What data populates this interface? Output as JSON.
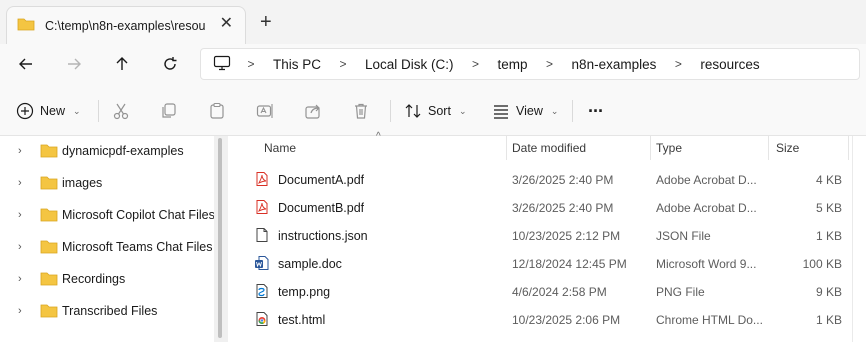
{
  "tab": {
    "title": "C:\\temp\\n8n-examples\\resou",
    "close": "✕",
    "new_tab": "+"
  },
  "nav": {
    "back": "back",
    "forward": "forward",
    "up": "up",
    "refresh": "refresh"
  },
  "breadcrumb": [
    "This PC",
    "Local Disk (C:)",
    "temp",
    "n8n-examples",
    "resources"
  ],
  "toolbar": {
    "new_label": "New",
    "sort_label": "Sort",
    "view_label": "View",
    "more": "···"
  },
  "sidebar": {
    "items": [
      {
        "label": "dynamicpdf-examples"
      },
      {
        "label": "images"
      },
      {
        "label": "Microsoft Copilot Chat Files"
      },
      {
        "label": "Microsoft Teams Chat Files"
      },
      {
        "label": "Recordings"
      },
      {
        "label": "Transcribed Files"
      }
    ]
  },
  "columns": {
    "name": "Name",
    "date": "Date modified",
    "type": "Type",
    "size": "Size"
  },
  "files": [
    {
      "name": "DocumentA.pdf",
      "date": "3/26/2025 2:40 PM",
      "type": "Adobe Acrobat D...",
      "size": "4 KB",
      "icon": "pdf-icon"
    },
    {
      "name": "DocumentB.pdf",
      "date": "3/26/2025 2:40 PM",
      "type": "Adobe Acrobat D...",
      "size": "5 KB",
      "icon": "pdf-icon"
    },
    {
      "name": "instructions.json",
      "date": "10/23/2025 2:12 PM",
      "type": "JSON File",
      "size": "1 KB",
      "icon": "file-icon"
    },
    {
      "name": "sample.doc",
      "date": "12/18/2024 12:45 PM",
      "type": "Microsoft Word 9...",
      "size": "100 KB",
      "icon": "word-icon"
    },
    {
      "name": "temp.png",
      "date": "4/6/2024 2:58 PM",
      "type": "PNG File",
      "size": "9 KB",
      "icon": "image-icon"
    },
    {
      "name": "test.html",
      "date": "10/23/2025 2:06 PM",
      "type": "Chrome HTML Do...",
      "size": "1 KB",
      "icon": "chrome-icon"
    }
  ],
  "colors": {
    "folder": "#f4c542",
    "pdf": "#d93025",
    "word": "#2b579a",
    "accent": "#005fb8"
  }
}
